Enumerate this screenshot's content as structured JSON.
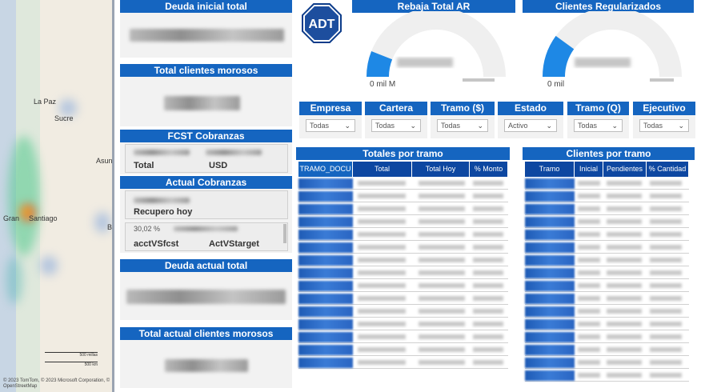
{
  "map": {
    "cities": [
      "La Paz",
      "Sucre",
      "Asun",
      "Gran",
      "Santiago",
      "B"
    ],
    "credit": "© 2023 TomTom, © 2023 Microsoft Corporation, © OpenStreetMap",
    "scale_miles": "500 millas",
    "scale_km": "500 km"
  },
  "logo": {
    "text": "ADT",
    "icon": "adt-octagon-logo"
  },
  "cards": {
    "deuda_inicial": "Deuda inicial total",
    "total_morosos": "Total clientes morosos",
    "fcst_cobranzas": "FCST Cobranzas",
    "fcst_total_label": "Total",
    "fcst_usd_label": "USD",
    "actual_cobranzas": "Actual Cobranzas",
    "recupero_hoy": "Recupero hoy",
    "acct_partial": "30,02 %",
    "acct_vs_fcst": "acctVSfcst",
    "act_vs_target": "ActVStarget",
    "deuda_actual": "Deuda actual total",
    "total_actual_morosos": "Total actual clientes morosos"
  },
  "gauges": {
    "rebaja": {
      "title": "Rebaja Total AR",
      "min": "0 mil M",
      "fill_fraction": 0.12
    },
    "clientes": {
      "title": "Clientes Regularizados",
      "min": "0 mil",
      "fill_fraction": 0.2
    }
  },
  "slicers": [
    {
      "label": "Empresa",
      "value": "Todas"
    },
    {
      "label": "Cartera",
      "value": "Todas"
    },
    {
      "label": "Tramo ($)",
      "value": "Todas"
    },
    {
      "label": "Estado",
      "value": "Activo"
    },
    {
      "label": "Tramo (Q)",
      "value": "Todas"
    },
    {
      "label": "Ejecutivo",
      "value": "Todas"
    }
  ],
  "tables": {
    "totales": {
      "title": "Totales por tramo",
      "columns": [
        "TRAMO_DOCU",
        "Total",
        "Total Hoy",
        "% Monto"
      ]
    },
    "clientes": {
      "title": "Clientes por tramo",
      "columns": [
        "Tramo",
        "Inicial",
        "Pendientes",
        "% Cantidad"
      ]
    }
  },
  "colors": {
    "accent": "#1565c0",
    "header_dark": "#0d47a1",
    "gauge_fill": "#1e88e5",
    "gauge_track": "#efefef"
  }
}
